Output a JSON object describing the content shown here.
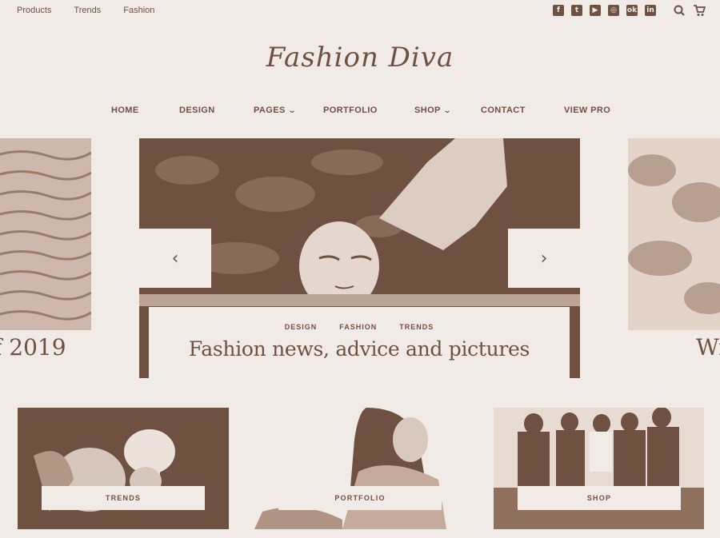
{
  "topbar": {
    "links": [
      "Products",
      "Trends",
      "Fashion"
    ],
    "social_icons": [
      "facebook-icon",
      "twitter-icon",
      "youtube-icon",
      "instagram-icon",
      "odnoklassniki-icon",
      "linkedin-icon"
    ]
  },
  "logo": {
    "text": "Fashion Diva"
  },
  "nav": {
    "items": [
      {
        "label": "HOME",
        "has_dropdown": false
      },
      {
        "label": "DESIGN",
        "has_dropdown": false
      },
      {
        "label": "PAGES",
        "has_dropdown": true
      },
      {
        "label": "PORTFOLIO",
        "has_dropdown": false
      },
      {
        "label": "SHOP",
        "has_dropdown": true
      },
      {
        "label": "CONTACT",
        "has_dropdown": false
      },
      {
        "label": "VIEW PRO",
        "has_dropdown": false
      }
    ]
  },
  "slider": {
    "prev_slide_title": "f 2019",
    "next_slide_title": "Wi",
    "active": {
      "categories": [
        "DESIGN",
        "FASHION",
        "TRENDS"
      ],
      "title": "Fashion news, advice and pictures"
    }
  },
  "cards": [
    {
      "label": "TRENDS"
    },
    {
      "label": "PORTFOLIO"
    },
    {
      "label": "SHOP"
    }
  ],
  "colors": {
    "background": "#f1ebe8",
    "accent": "#6e5141"
  }
}
